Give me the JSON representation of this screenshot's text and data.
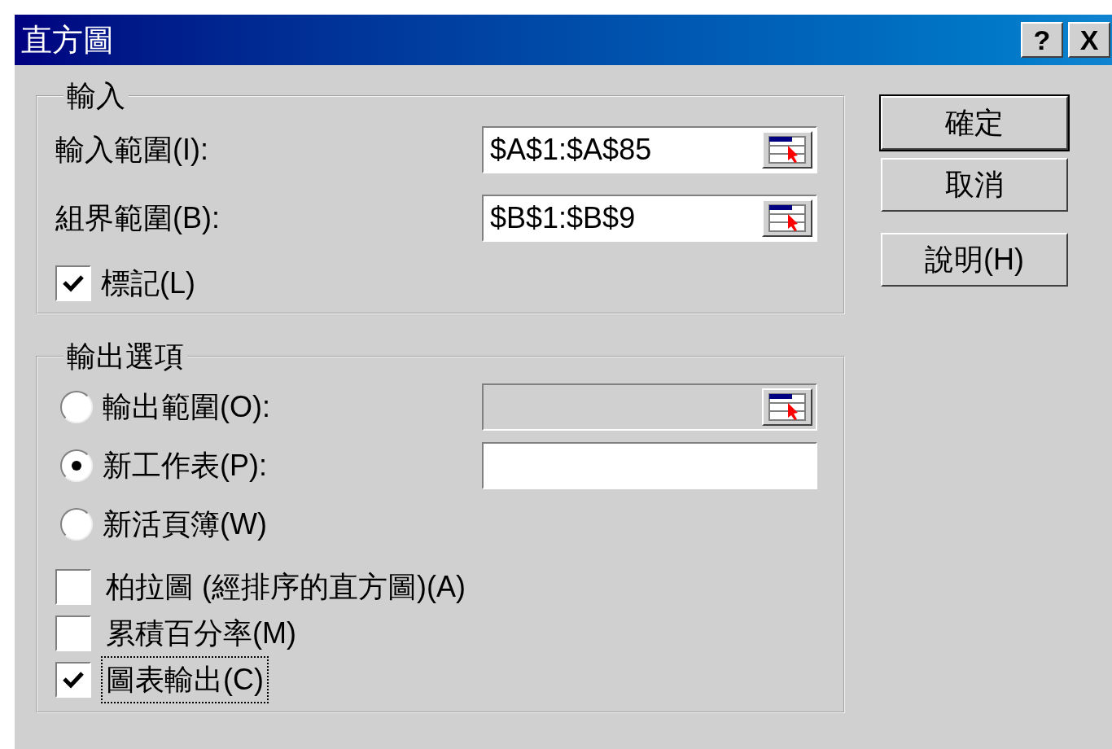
{
  "window": {
    "title": "直方圖",
    "help_button": "?",
    "close_button": "X"
  },
  "input_group": {
    "legend": "輸入",
    "fields": [
      {
        "label": "輸入範圍(I):",
        "value": "$A$1:$A$85"
      },
      {
        "label": "組界範圍(B):",
        "value": "$B$1:$B$9"
      }
    ],
    "labels_checkbox": {
      "label": "標記(L)",
      "checked": true
    }
  },
  "output_group": {
    "legend": "輸出選項",
    "options": [
      {
        "label": "輸出範圍(O):",
        "selected": false,
        "kind": "ref",
        "disabled": true
      },
      {
        "label": "新工作表(P):",
        "selected": true,
        "kind": "plain",
        "disabled": false
      },
      {
        "label": "新活頁簿(W)",
        "selected": false,
        "kind": "none"
      }
    ],
    "checkboxes": [
      {
        "label": "柏拉圖 (經排序的直方圖)(A)",
        "checked": false,
        "focused": false
      },
      {
        "label": "累積百分率(M)",
        "checked": false,
        "focused": false
      },
      {
        "label": "圖表輸出(C)",
        "checked": true,
        "focused": true
      }
    ]
  },
  "buttons": [
    {
      "label": "確定",
      "default": true
    },
    {
      "label": "取消",
      "default": false
    },
    {
      "label": "說明(H)",
      "default": false
    }
  ]
}
